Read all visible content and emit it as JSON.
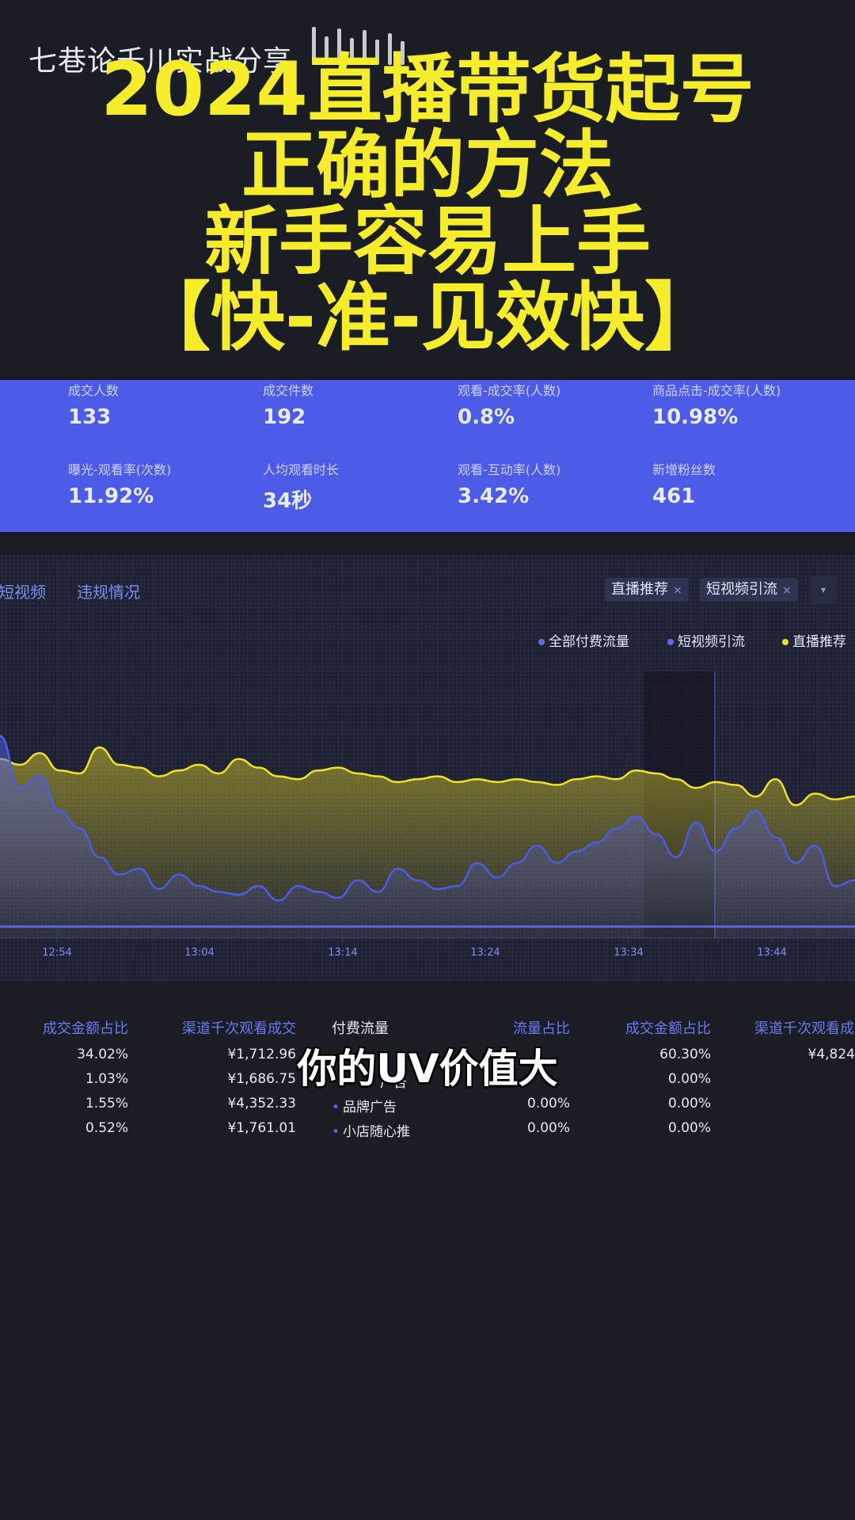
{
  "watermark": "七巷论千川实战分享",
  "title_lines": [
    "2024直播带货起号",
    "正确的方法",
    "新手容易上手",
    "【快-准-见效快】"
  ],
  "stats": [
    {
      "label": "成交人数",
      "value": "133"
    },
    {
      "label": "成交件数",
      "value": "192"
    },
    {
      "label": "观看-成交率(人数)",
      "value": "0.8%"
    },
    {
      "label": "商品点击-成交率(人数)",
      "value": "10.98%"
    },
    {
      "label": "曝光-观看率(次数)",
      "value": "11.92%"
    },
    {
      "label": "人均观看时长",
      "value": "34秒"
    },
    {
      "label": "观看-互动率(人数)",
      "value": "3.42%"
    },
    {
      "label": "新增粉丝数",
      "value": "461"
    }
  ],
  "tabs": [
    "短视频",
    "违规情况"
  ],
  "chips": [
    "直播推荐",
    "短视频引流"
  ],
  "chip_close": "×",
  "dropdown_icon": "chevron-down-icon",
  "legend": [
    {
      "name": "全部付费流量",
      "color": "#5b6cf0"
    },
    {
      "name": "短视频引流",
      "color": "#5b6cf0"
    },
    {
      "name": "直播推荐",
      "color": "#f0e028"
    }
  ],
  "colors": {
    "accent": "#4d5ce8",
    "yellow_series": "#f0e028",
    "blue_series": "#4c5ce6"
  },
  "chart_data": {
    "type": "area",
    "x_ticks": [
      "12:54",
      "13:04",
      "13:14",
      "13:24",
      "13:34",
      "13:44"
    ],
    "series": [
      {
        "name": "直播推荐",
        "values": [
          62,
          60,
          64,
          58,
          57,
          66,
          60,
          59,
          56,
          58,
          60,
          57,
          62,
          59,
          56,
          55,
          58,
          59,
          57,
          56,
          54,
          55,
          56,
          54,
          55,
          54,
          55,
          54,
          53,
          55,
          56,
          55,
          58,
          57,
          55,
          52,
          54,
          53,
          49,
          55,
          46,
          50,
          48,
          49
        ]
      },
      {
        "name": "短视频引流",
        "values": [
          70,
          52,
          56,
          44,
          38,
          28,
          22,
          24,
          17,
          22,
          18,
          16,
          15,
          18,
          13,
          18,
          16,
          14,
          20,
          16,
          24,
          20,
          17,
          18,
          26,
          21,
          26,
          32,
          26,
          30,
          33,
          38,
          42,
          36,
          28,
          40,
          30,
          38,
          44,
          35,
          26,
          32,
          18,
          20
        ]
      },
      {
        "name": "全部付费流量",
        "values": [
          4,
          4,
          4,
          4,
          4,
          4,
          4,
          4,
          4,
          4,
          4,
          4,
          4,
          4,
          4,
          4,
          4,
          4,
          4,
          4,
          4,
          4,
          4,
          4,
          4,
          4,
          4,
          4,
          4,
          4,
          4,
          4,
          4,
          4,
          4,
          4,
          4,
          4,
          4,
          4,
          4,
          4,
          4,
          4
        ]
      }
    ]
  },
  "table": {
    "left_headers": [
      "成交金额占比",
      "渠道千次观看成交"
    ],
    "left_rows": [
      [
        "34.02%",
        "¥1,712.96"
      ],
      [
        "1.03%",
        "¥1,686.75"
      ],
      [
        "1.55%",
        "¥4,352.33"
      ],
      [
        "0.52%",
        "¥1,761.01"
      ]
    ],
    "right_headers": [
      "付费流量",
      "流量占比",
      "成交金额占比",
      "渠道千次观看成"
    ],
    "right_rows": [
      {
        "name": "",
        "share": "",
        "gmv": "60.30%",
        "gpm": "¥4,824"
      },
      {
        "name": "广告",
        "share": "",
        "gmv": "0.00%",
        "gpm": ""
      },
      {
        "name": "品牌广告",
        "share": "0.00%",
        "gmv": "0.00%",
        "gpm": ""
      },
      {
        "name": "小店随心推",
        "share": "0.00%",
        "gmv": "0.00%",
        "gpm": ""
      }
    ]
  },
  "subtitle": "你的UV价值大"
}
